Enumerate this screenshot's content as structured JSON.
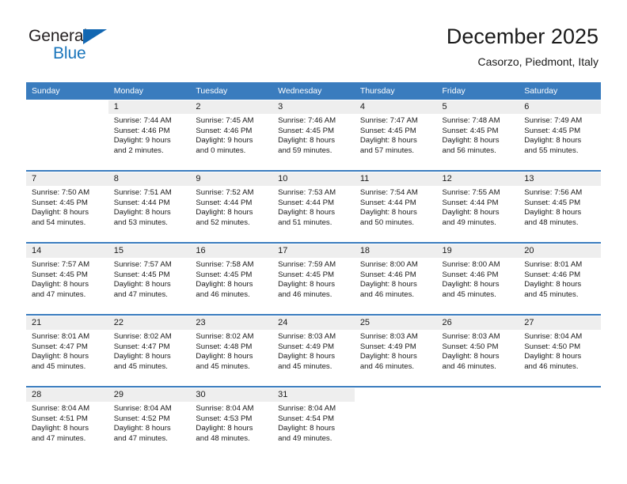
{
  "brand": {
    "name_top": "General",
    "name_bottom": "Blue",
    "triangle_color": "#1267b2",
    "top_color": "#231f20",
    "bottom_color": "#1a75bb"
  },
  "header": {
    "title": "December 2025",
    "subtitle": "Casorzo, Piedmont, Italy"
  },
  "theme": {
    "header_bg": "#3a7cbe",
    "daynum_bg": "#eeeeee",
    "text": "#1a1a1a"
  },
  "calendar": {
    "weekday_headers": [
      "Sunday",
      "Monday",
      "Tuesday",
      "Wednesday",
      "Thursday",
      "Friday",
      "Saturday"
    ],
    "weeks": [
      [
        {
          "day": "",
          "lines": []
        },
        {
          "day": "1",
          "lines": [
            "Sunrise: 7:44 AM",
            "Sunset: 4:46 PM",
            "Daylight: 9 hours",
            "and 2 minutes."
          ]
        },
        {
          "day": "2",
          "lines": [
            "Sunrise: 7:45 AM",
            "Sunset: 4:46 PM",
            "Daylight: 9 hours",
            "and 0 minutes."
          ]
        },
        {
          "day": "3",
          "lines": [
            "Sunrise: 7:46 AM",
            "Sunset: 4:45 PM",
            "Daylight: 8 hours",
            "and 59 minutes."
          ]
        },
        {
          "day": "4",
          "lines": [
            "Sunrise: 7:47 AM",
            "Sunset: 4:45 PM",
            "Daylight: 8 hours",
            "and 57 minutes."
          ]
        },
        {
          "day": "5",
          "lines": [
            "Sunrise: 7:48 AM",
            "Sunset: 4:45 PM",
            "Daylight: 8 hours",
            "and 56 minutes."
          ]
        },
        {
          "day": "6",
          "lines": [
            "Sunrise: 7:49 AM",
            "Sunset: 4:45 PM",
            "Daylight: 8 hours",
            "and 55 minutes."
          ]
        }
      ],
      [
        {
          "day": "7",
          "lines": [
            "Sunrise: 7:50 AM",
            "Sunset: 4:45 PM",
            "Daylight: 8 hours",
            "and 54 minutes."
          ]
        },
        {
          "day": "8",
          "lines": [
            "Sunrise: 7:51 AM",
            "Sunset: 4:44 PM",
            "Daylight: 8 hours",
            "and 53 minutes."
          ]
        },
        {
          "day": "9",
          "lines": [
            "Sunrise: 7:52 AM",
            "Sunset: 4:44 PM",
            "Daylight: 8 hours",
            "and 52 minutes."
          ]
        },
        {
          "day": "10",
          "lines": [
            "Sunrise: 7:53 AM",
            "Sunset: 4:44 PM",
            "Daylight: 8 hours",
            "and 51 minutes."
          ]
        },
        {
          "day": "11",
          "lines": [
            "Sunrise: 7:54 AM",
            "Sunset: 4:44 PM",
            "Daylight: 8 hours",
            "and 50 minutes."
          ]
        },
        {
          "day": "12",
          "lines": [
            "Sunrise: 7:55 AM",
            "Sunset: 4:44 PM",
            "Daylight: 8 hours",
            "and 49 minutes."
          ]
        },
        {
          "day": "13",
          "lines": [
            "Sunrise: 7:56 AM",
            "Sunset: 4:45 PM",
            "Daylight: 8 hours",
            "and 48 minutes."
          ]
        }
      ],
      [
        {
          "day": "14",
          "lines": [
            "Sunrise: 7:57 AM",
            "Sunset: 4:45 PM",
            "Daylight: 8 hours",
            "and 47 minutes."
          ]
        },
        {
          "day": "15",
          "lines": [
            "Sunrise: 7:57 AM",
            "Sunset: 4:45 PM",
            "Daylight: 8 hours",
            "and 47 minutes."
          ]
        },
        {
          "day": "16",
          "lines": [
            "Sunrise: 7:58 AM",
            "Sunset: 4:45 PM",
            "Daylight: 8 hours",
            "and 46 minutes."
          ]
        },
        {
          "day": "17",
          "lines": [
            "Sunrise: 7:59 AM",
            "Sunset: 4:45 PM",
            "Daylight: 8 hours",
            "and 46 minutes."
          ]
        },
        {
          "day": "18",
          "lines": [
            "Sunrise: 8:00 AM",
            "Sunset: 4:46 PM",
            "Daylight: 8 hours",
            "and 46 minutes."
          ]
        },
        {
          "day": "19",
          "lines": [
            "Sunrise: 8:00 AM",
            "Sunset: 4:46 PM",
            "Daylight: 8 hours",
            "and 45 minutes."
          ]
        },
        {
          "day": "20",
          "lines": [
            "Sunrise: 8:01 AM",
            "Sunset: 4:46 PM",
            "Daylight: 8 hours",
            "and 45 minutes."
          ]
        }
      ],
      [
        {
          "day": "21",
          "lines": [
            "Sunrise: 8:01 AM",
            "Sunset: 4:47 PM",
            "Daylight: 8 hours",
            "and 45 minutes."
          ]
        },
        {
          "day": "22",
          "lines": [
            "Sunrise: 8:02 AM",
            "Sunset: 4:47 PM",
            "Daylight: 8 hours",
            "and 45 minutes."
          ]
        },
        {
          "day": "23",
          "lines": [
            "Sunrise: 8:02 AM",
            "Sunset: 4:48 PM",
            "Daylight: 8 hours",
            "and 45 minutes."
          ]
        },
        {
          "day": "24",
          "lines": [
            "Sunrise: 8:03 AM",
            "Sunset: 4:49 PM",
            "Daylight: 8 hours",
            "and 45 minutes."
          ]
        },
        {
          "day": "25",
          "lines": [
            "Sunrise: 8:03 AM",
            "Sunset: 4:49 PM",
            "Daylight: 8 hours",
            "and 46 minutes."
          ]
        },
        {
          "day": "26",
          "lines": [
            "Sunrise: 8:03 AM",
            "Sunset: 4:50 PM",
            "Daylight: 8 hours",
            "and 46 minutes."
          ]
        },
        {
          "day": "27",
          "lines": [
            "Sunrise: 8:04 AM",
            "Sunset: 4:50 PM",
            "Daylight: 8 hours",
            "and 46 minutes."
          ]
        }
      ],
      [
        {
          "day": "28",
          "lines": [
            "Sunrise: 8:04 AM",
            "Sunset: 4:51 PM",
            "Daylight: 8 hours",
            "and 47 minutes."
          ]
        },
        {
          "day": "29",
          "lines": [
            "Sunrise: 8:04 AM",
            "Sunset: 4:52 PM",
            "Daylight: 8 hours",
            "and 47 minutes."
          ]
        },
        {
          "day": "30",
          "lines": [
            "Sunrise: 8:04 AM",
            "Sunset: 4:53 PM",
            "Daylight: 8 hours",
            "and 48 minutes."
          ]
        },
        {
          "day": "31",
          "lines": [
            "Sunrise: 8:04 AM",
            "Sunset: 4:54 PM",
            "Daylight: 8 hours",
            "and 49 minutes."
          ]
        },
        {
          "day": "",
          "lines": []
        },
        {
          "day": "",
          "lines": []
        },
        {
          "day": "",
          "lines": []
        }
      ]
    ]
  }
}
